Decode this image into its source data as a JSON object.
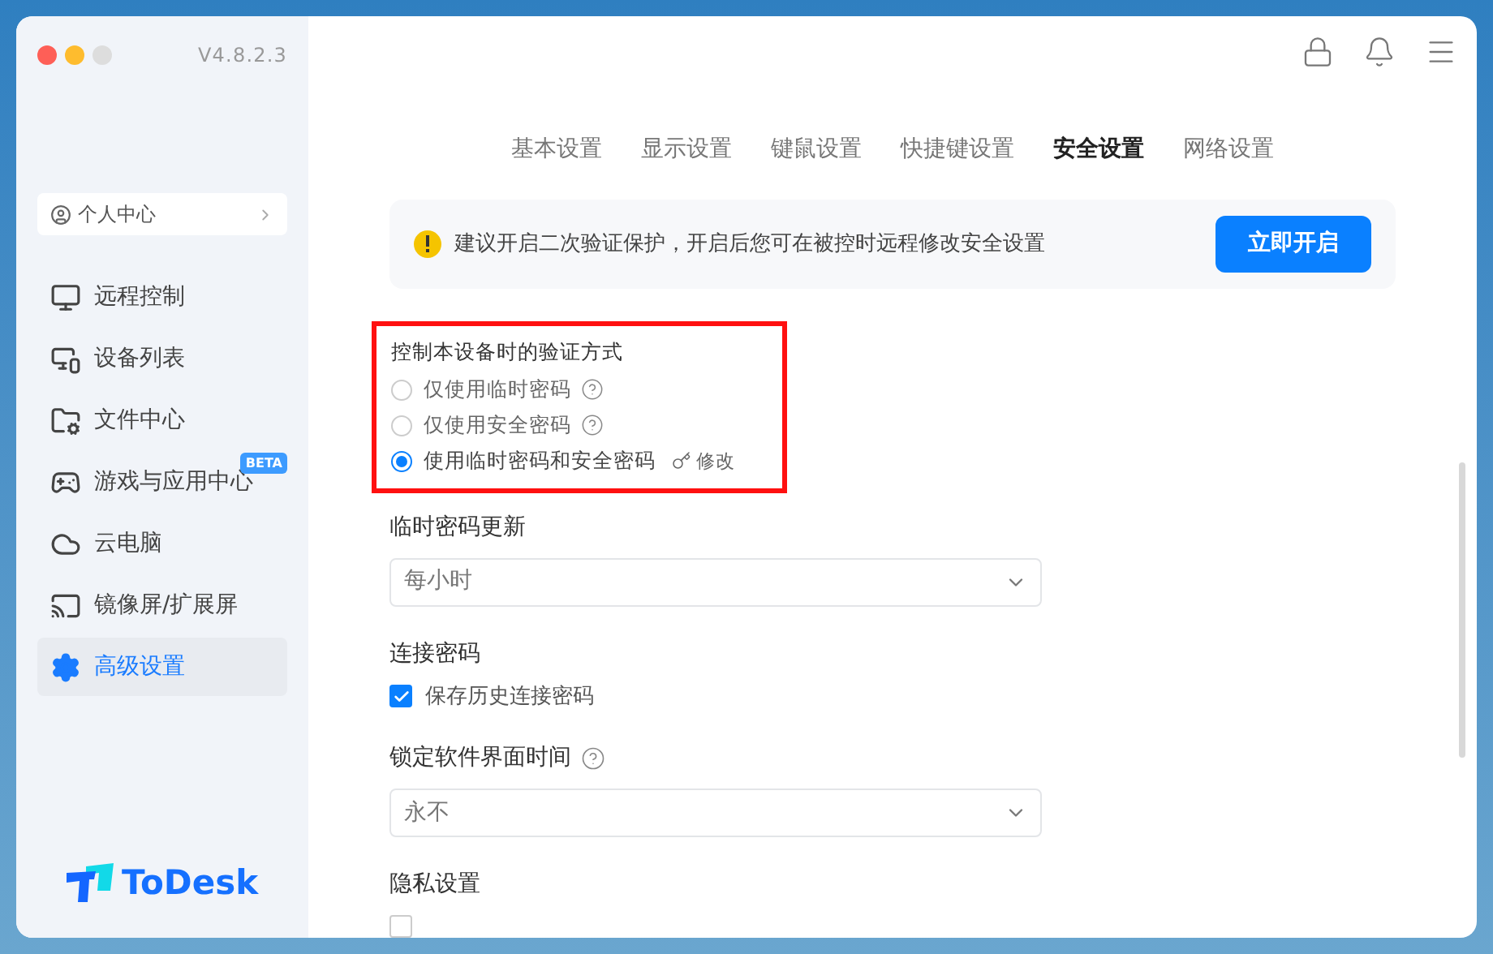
{
  "window": {
    "version": "V4.8.2.3"
  },
  "sidebar": {
    "profile": {
      "label": "个人中心"
    },
    "items": [
      {
        "kind": "remote",
        "label": "远程控制",
        "selected": false
      },
      {
        "kind": "devices",
        "label": "设备列表",
        "selected": false
      },
      {
        "kind": "files",
        "label": "文件中心",
        "selected": false
      },
      {
        "kind": "games",
        "label": "游戏与应用中心",
        "selected": false,
        "badge": "BETA"
      },
      {
        "kind": "cloud",
        "label": "云电脑",
        "selected": false
      },
      {
        "kind": "mirror",
        "label": "镜像屏/扩展屏",
        "selected": false
      },
      {
        "kind": "settings",
        "label": "高级设置",
        "selected": true
      }
    ],
    "logo": "ToDesk"
  },
  "tabs": [
    {
      "label": "基本设置",
      "selected": false
    },
    {
      "label": "显示设置",
      "selected": false
    },
    {
      "label": "键鼠设置",
      "selected": false
    },
    {
      "label": "快捷键设置",
      "selected": false
    },
    {
      "label": "安全设置",
      "selected": true
    },
    {
      "label": "网络设置",
      "selected": false
    }
  ],
  "banner": {
    "text": "建议开启二次验证保护，开启后您可在被控时远程修改安全设置",
    "button": "立即开启"
  },
  "verification": {
    "title": "控制本设备时的验证方式",
    "options": [
      {
        "label": "仅使用临时密码",
        "selected": false,
        "help": true
      },
      {
        "label": "仅使用安全密码",
        "selected": false,
        "help": true
      },
      {
        "label": "使用临时密码和安全密码",
        "selected": true,
        "help": false,
        "action": "修改"
      }
    ]
  },
  "temp_password_update": {
    "title": "临时密码更新",
    "value": "每小时"
  },
  "connection_password": {
    "title": "连接密码",
    "checkbox": {
      "label": "保存历史连接密码",
      "checked": true
    }
  },
  "lock_time": {
    "title": "锁定软件界面时间",
    "value": "永不"
  },
  "privacy": {
    "title": "隐私设置",
    "checkbox": {
      "checked": false
    }
  }
}
